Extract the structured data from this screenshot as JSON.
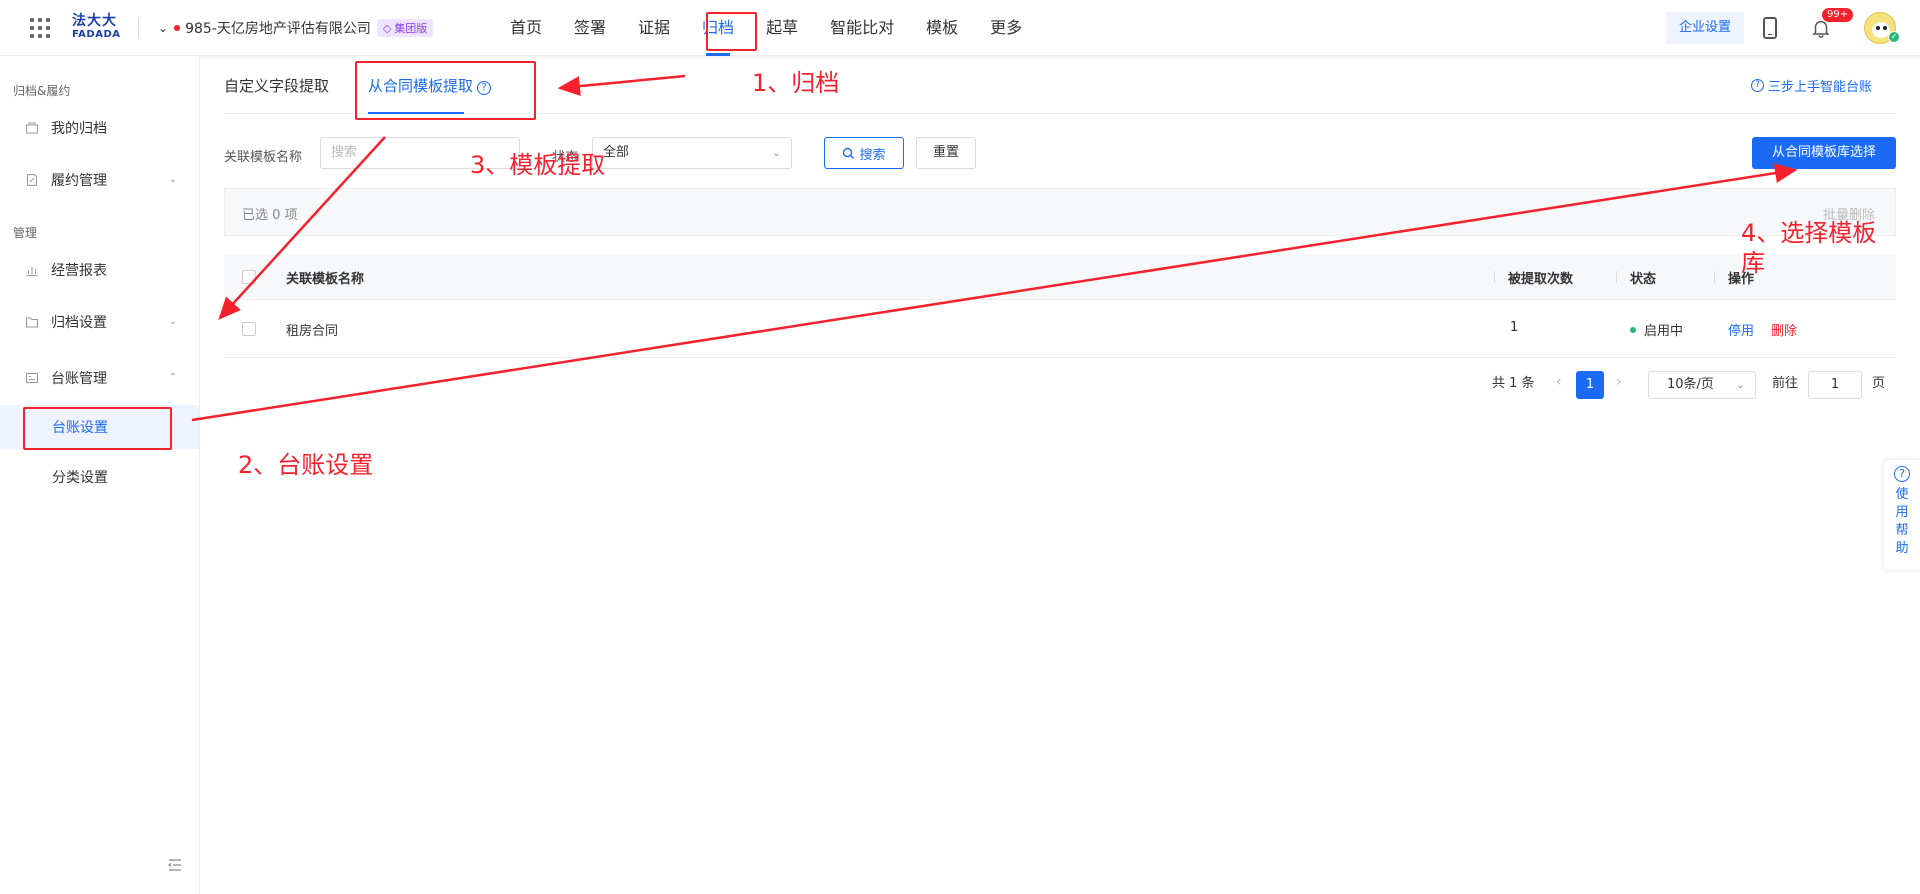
{
  "header": {
    "logo_cn": "法大大",
    "logo_en": "FADADA",
    "company": "985-天亿房地产评估有限公司",
    "company_badge": "集团版",
    "nav": [
      "首页",
      "签署",
      "证据",
      "归档",
      "起草",
      "智能比对",
      "模板",
      "更多"
    ],
    "active_nav": "归档",
    "enterprise_settings": "企业设置",
    "notification_count": "99+"
  },
  "sidebar": {
    "group1": "归档&履约",
    "my_archive": "我的归档",
    "contract_perf": "履约管理",
    "group2": "管理",
    "reports": "经营报表",
    "archive_settings": "归档设置",
    "ledger_mgmt": "台账管理",
    "ledger_settings": "台账设置",
    "category_settings": "分类设置"
  },
  "tabs": {
    "custom_field": "自定义字段提取",
    "from_template": "从合同模板提取",
    "guide_link": "三步上手智能台账"
  },
  "filters": {
    "template_name_label": "关联模板名称",
    "template_name_placeholder": "搜索",
    "status_label": "状态",
    "status_value": "全部",
    "search_button": "搜索",
    "reset_button": "重置",
    "select_from_library": "从合同模板库选择"
  },
  "selection": {
    "count_text": "已选 0 项",
    "batch_delete": "批量删除"
  },
  "table": {
    "columns": [
      "关联模板名称",
      "被提取次数",
      "状态",
      "操作"
    ],
    "rows": [
      {
        "name": "租房合同",
        "count": "1",
        "status": "启用中",
        "action_disable": "停用",
        "action_delete": "删除"
      }
    ]
  },
  "pagination": {
    "total": "共 1 条",
    "current_page": "1",
    "page_size": "10条/页",
    "goto_label": "前往",
    "goto_value": "1",
    "page_suffix": "页"
  },
  "help_float": {
    "chars": [
      "使",
      "用",
      "帮",
      "助"
    ]
  },
  "annotations": {
    "step1": "1、归档",
    "step2": "2、台账设置",
    "step3": "3、模板提取",
    "step4": "4、选择模板库"
  },
  "colors": {
    "primary": "#1b6bf7",
    "annotation": "#f5222d",
    "status_active": "#2bb673"
  }
}
